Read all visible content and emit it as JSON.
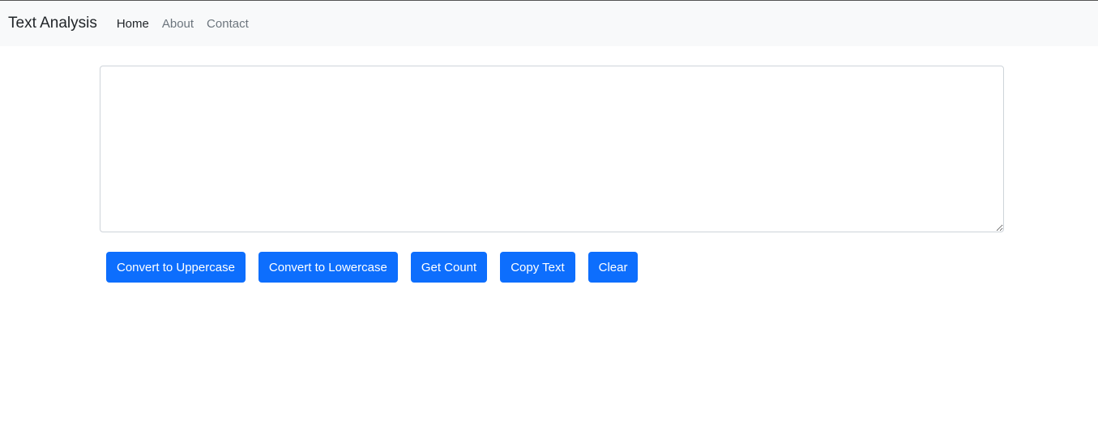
{
  "navbar": {
    "brand": "Text Analysis",
    "links": [
      {
        "label": "Home",
        "active": true
      },
      {
        "label": "About",
        "active": false
      },
      {
        "label": "Contact",
        "active": false
      }
    ]
  },
  "main": {
    "textarea": {
      "value": "",
      "placeholder": ""
    },
    "buttons": [
      {
        "label": "Convert to Uppercase"
      },
      {
        "label": "Convert to Lowercase"
      },
      {
        "label": "Get Count"
      },
      {
        "label": "Copy Text"
      },
      {
        "label": "Clear"
      }
    ]
  },
  "colors": {
    "primary": "#0d6efd",
    "navbar_bg": "#f8f9fa"
  }
}
